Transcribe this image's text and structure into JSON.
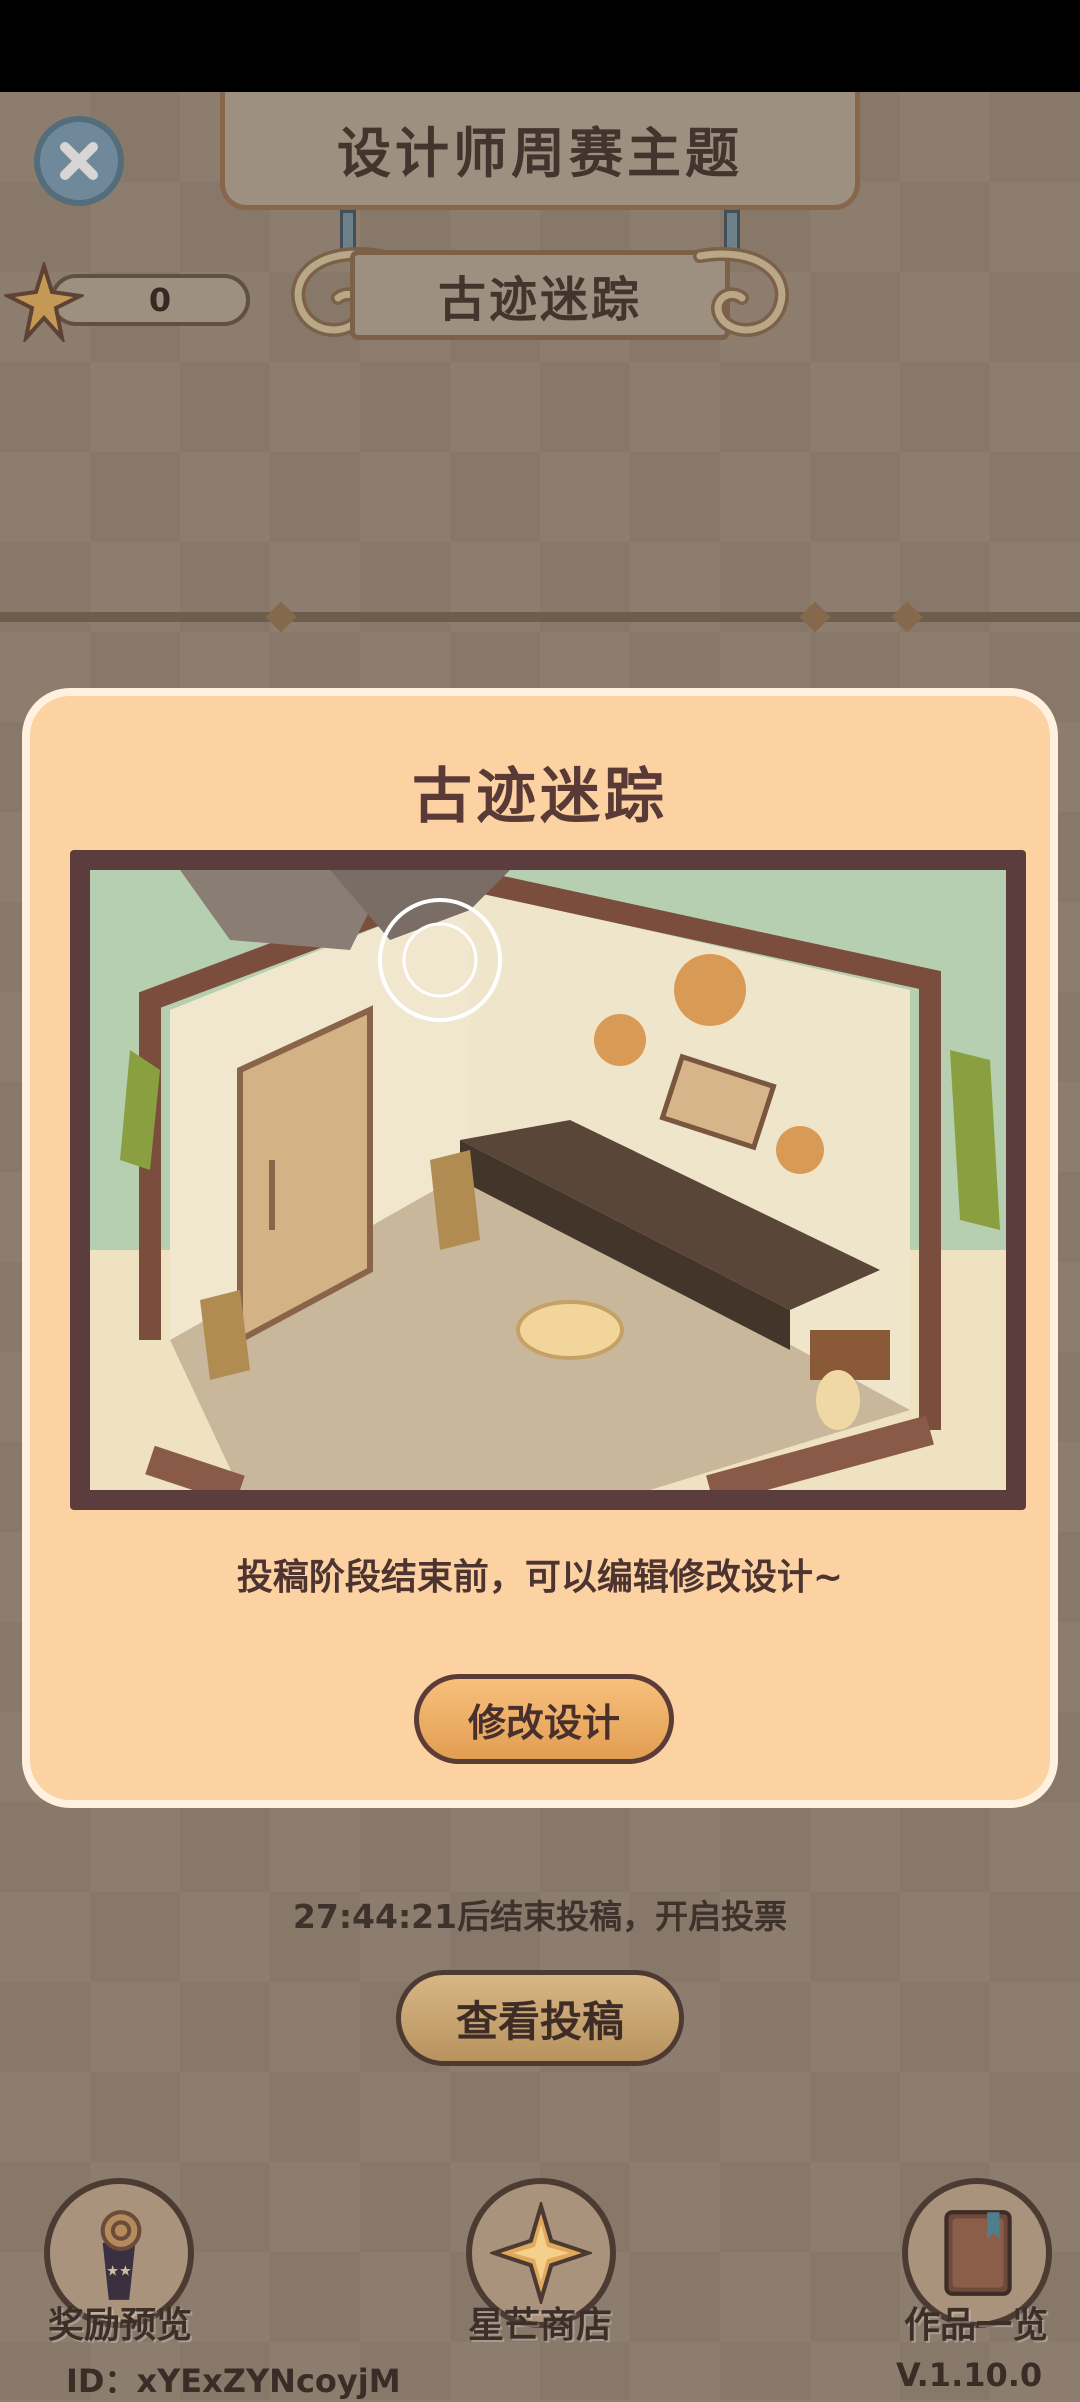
{
  "header": {
    "title": "设计师周赛主题",
    "theme_name": "古迹迷踪",
    "star_count": "0"
  },
  "modal": {
    "title": "古迹迷踪",
    "description": "投稿阶段结束前，可以编辑修改设计~",
    "modify_button": "修改设计"
  },
  "submission": {
    "timer_text": "27:44:21后结束投稿，开启投票",
    "view_button": "查看投稿"
  },
  "bottom_nav": [
    {
      "label": "奖励预览",
      "icon": "trophy-icon"
    },
    {
      "label": "星芒商店",
      "icon": "compass-star-icon"
    },
    {
      "label": "作品一览",
      "icon": "book-icon"
    }
  ],
  "footer": {
    "user_id": "ID：xYExZYNcoyjM",
    "version": "V.1.10.0"
  },
  "colors": {
    "modal_bg": "#fcd2a2",
    "button_accent": "#e29e52",
    "close_button": "#7fa2b8"
  }
}
